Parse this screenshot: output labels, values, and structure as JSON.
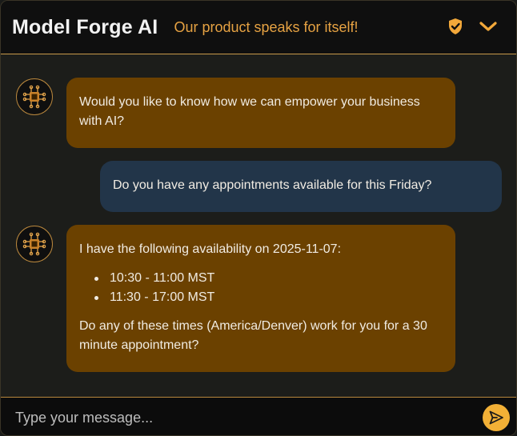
{
  "header": {
    "brand": "Model Forge AI",
    "tagline": "Our product speaks for itself!",
    "shield_icon": "shield-check-icon",
    "collapse_icon": "chevron-down-icon"
  },
  "messages": [
    {
      "role": "bot",
      "text": "Would you like to know how we can empower your business with AI?"
    },
    {
      "role": "user",
      "text": "Do you have any appointments available for this Friday?"
    },
    {
      "role": "bot",
      "intro": "I have the following availability on 2025-11-07:",
      "slots": [
        "10:30 - 11:00 MST",
        "11:30 - 17:00 MST"
      ],
      "outro": "Do any of these times (America/Denver) work for you for a 30 minute appointment?"
    }
  ],
  "composer": {
    "placeholder": "Type your message...",
    "value": "",
    "send_icon": "send-icon"
  },
  "colors": {
    "header_bg": "#0f0f0f",
    "accent": "#e6a243",
    "bot_bubble": "#6b4100",
    "user_bubble": "#223549",
    "send_button": "#f2b036"
  }
}
